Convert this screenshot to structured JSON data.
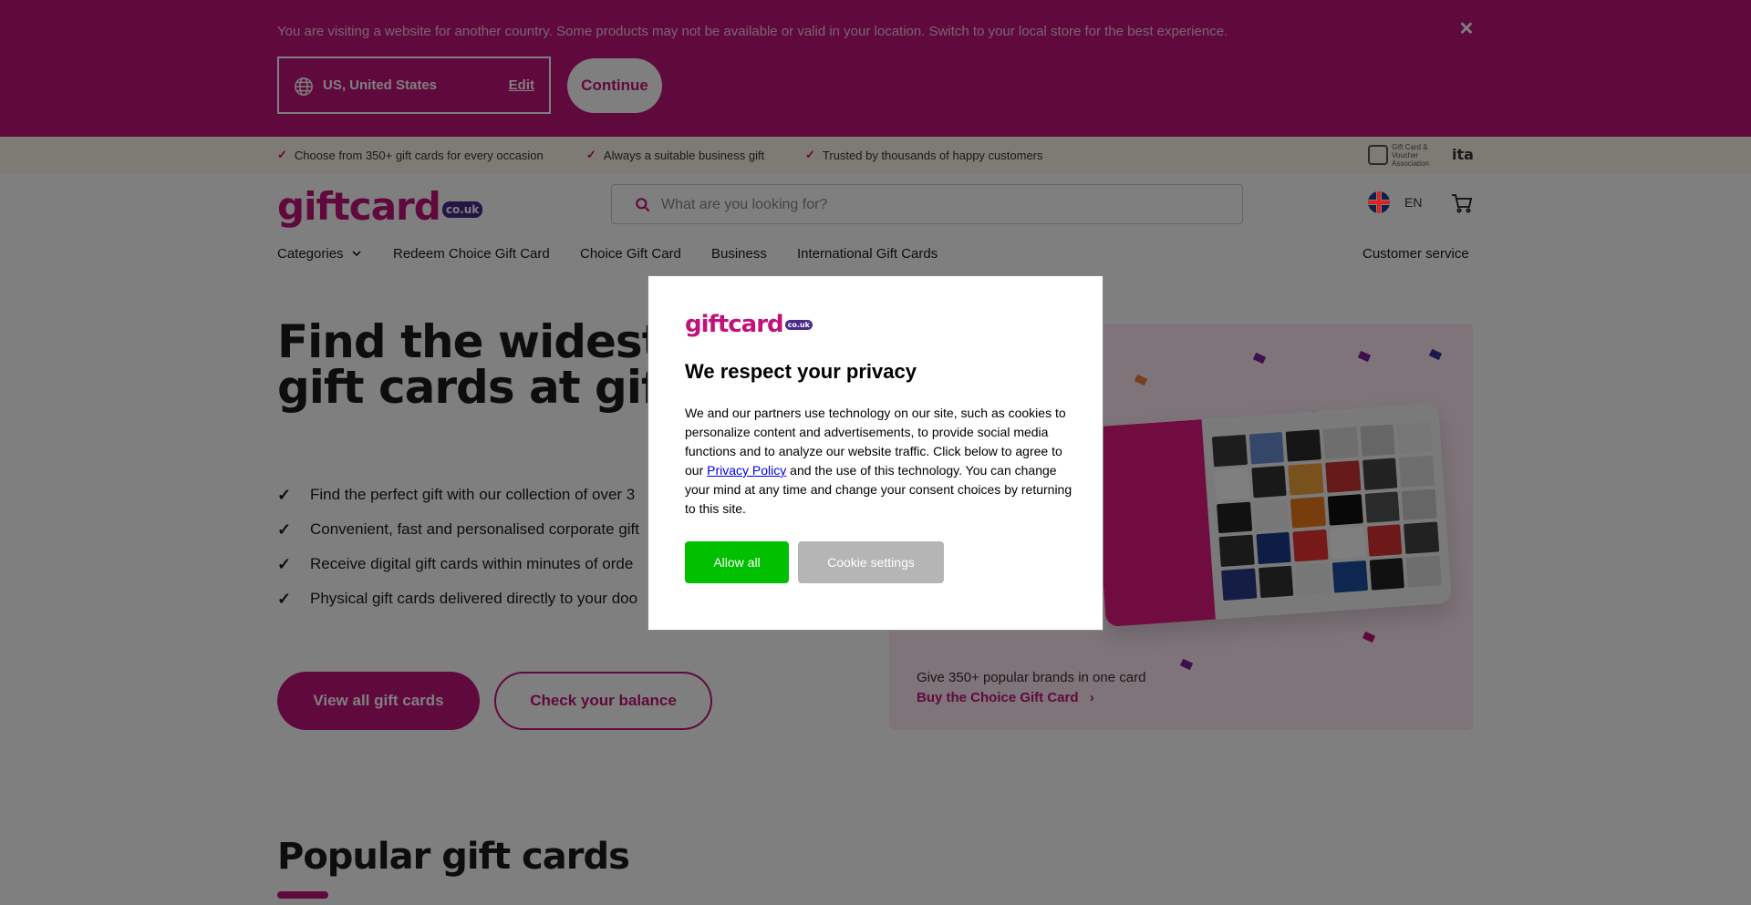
{
  "country_banner": {
    "message": "You are visiting a website for another country. Some products may not be available or valid in your location. Switch to your local store for the best experience.",
    "country": "US, United States",
    "edit_label": "Edit",
    "continue_label": "Continue",
    "close_icon": "close-icon",
    "close_glyph": "✕"
  },
  "usp_bar": {
    "items": [
      "Choose from 350+ gift cards for every occasion",
      "Always a suitable business gift",
      "Trusted by thousands of happy customers"
    ],
    "check_glyph": "✓",
    "association_logo": "Gift Card & Voucher Association",
    "ita_logo": "ita"
  },
  "header": {
    "logo_text": "giftcard",
    "logo_suffix": "co.uk",
    "search_placeholder": "What are you looking for?",
    "language": "EN"
  },
  "nav": {
    "items": [
      "Categories",
      "Redeem Choice Gift Card",
      "Choice Gift Card",
      "Business",
      "International Gift Cards"
    ],
    "customer_service": "Customer service"
  },
  "hero": {
    "title_line1": "Find the widest ra",
    "title_line2": "gift cards at giftca",
    "check_glyph": "✓",
    "bullets": [
      "Find the perfect gift with our collection of over 3",
      "Convenient, fast and personalised corporate gift",
      "Receive digital gift cards within minutes of orde",
      "Physical gift cards delivered directly to your doo"
    ],
    "primary_button": "View all gift cards",
    "secondary_button": "Check your balance"
  },
  "choice_panel": {
    "text": "Give 350+ popular brands in one card",
    "link": "Buy the Choice Gift Card",
    "link_glyph": "›"
  },
  "popular": {
    "title": "Popular gift cards"
  },
  "privacy_modal": {
    "logo_text": "giftcard",
    "logo_suffix": "co.uk",
    "title": "We respect your privacy",
    "body_before": "We and our partners use technology on our site, such as cookies to personalize content and advertisements, to provide social media functions and to analyze our website traffic. Click below to agree to our ",
    "privacy_link": "Privacy Policy",
    "body_after": " and the use of this technology. You can change your mind at any time and change your consent choices by returning to this site.",
    "allow_label": "Allow all",
    "settings_label": "Cookie settings"
  },
  "colors": {
    "brand": "#c0127a",
    "allow_button": "#00c000",
    "settings_button": "#b5b5b5"
  }
}
